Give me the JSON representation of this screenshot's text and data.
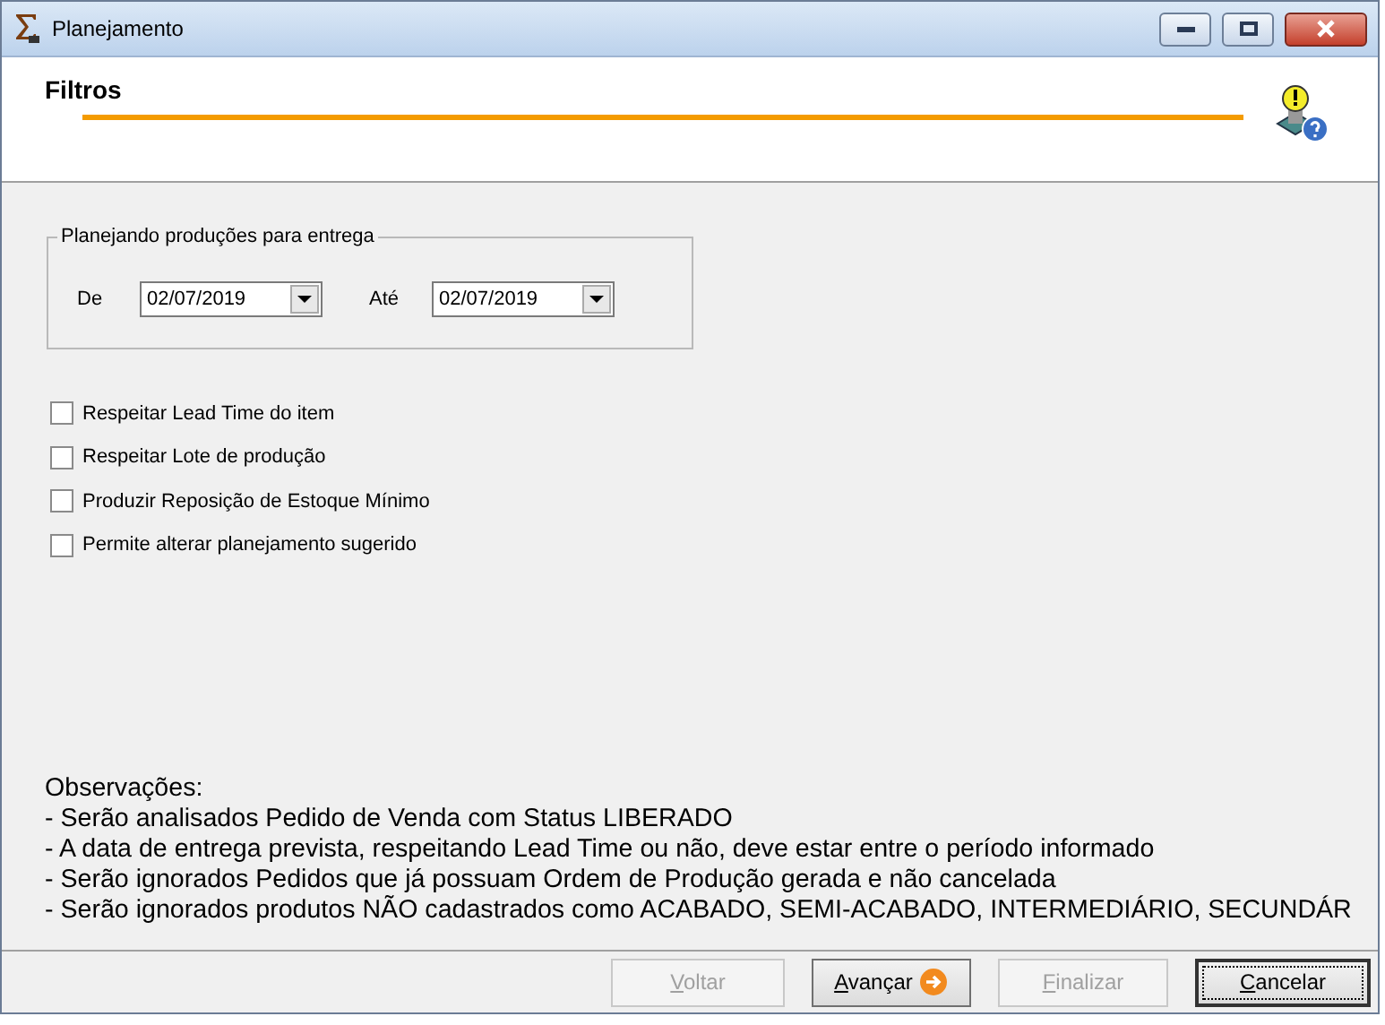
{
  "window": {
    "title": "Planejamento"
  },
  "header": {
    "title": "Filtros"
  },
  "period": {
    "legend": "Planejando produções para entrega",
    "from_label": "De",
    "from_value": "02/07/2019",
    "to_label": "Até",
    "to_value": "02/07/2019"
  },
  "options": [
    {
      "label": "Respeitar Lead Time do item",
      "checked": false
    },
    {
      "label": "Respeitar Lote de produção",
      "checked": false
    },
    {
      "label": "Produzir Reposição de Estoque Mínimo",
      "checked": false
    },
    {
      "label": "Permite alterar planejamento sugerido",
      "checked": false
    }
  ],
  "notes": {
    "title": "Observações:",
    "lines": [
      "- Serão analisados Pedido de Venda com Status LIBERADO",
      "- A data de entrega prevista, respeitando Lead Time ou não, deve estar entre o período informado",
      "- Serão ignorados Pedidos que já possuam Ordem de Produção gerada e não cancelada",
      "- Serão ignorados produtos NÃO cadastrados como ACABADO, SEMI-ACABADO, INTERMEDIÁRIO, SECUNDÁR"
    ]
  },
  "buttons": [
    {
      "label": "Voltar",
      "kind": "plain",
      "disabled": true,
      "focused": false
    },
    {
      "label": "Avançar",
      "kind": "next",
      "disabled": false,
      "focused": false
    },
    {
      "label": "Finalizar",
      "kind": "plain",
      "disabled": true,
      "focused": false
    },
    {
      "label": "Cancelar",
      "kind": "plain",
      "disabled": false,
      "focused": true
    }
  ]
}
